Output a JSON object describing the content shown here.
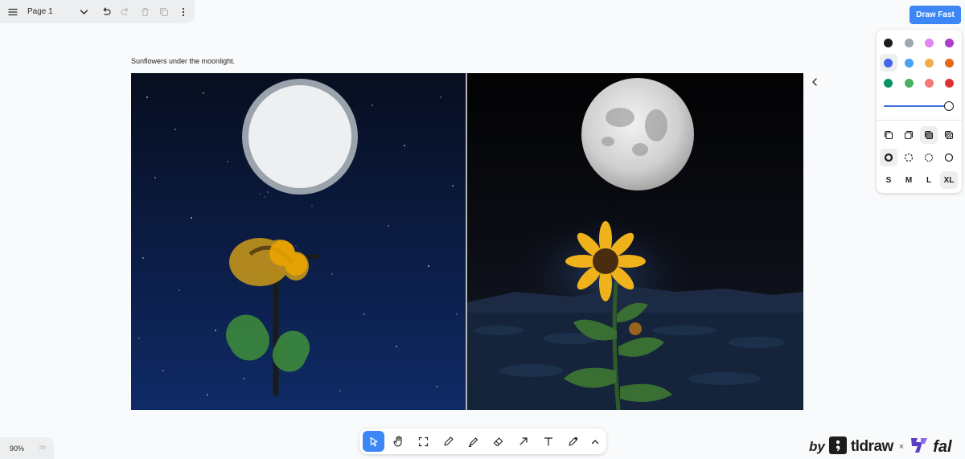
{
  "app": {
    "page": {
      "label": "Page 1"
    },
    "menu_icon": "hamburger-icon",
    "page_menu_icon": "chevron-down-icon",
    "undo_icon": "undo-icon",
    "redo_icon": "redo-icon",
    "delete_icon": "trash-icon",
    "duplicate_icon": "duplicate-icon",
    "more_icon": "more-vertical-icon"
  },
  "draw_fast": {
    "label": "Draw Fast",
    "color": "#3d86f5"
  },
  "style_panel": {
    "colors": [
      "#1d1d1d",
      "#9fa8b2",
      "#e085f4",
      "#ae3ec9",
      "#4465e9",
      "#4ba1f1",
      "#f1ac4b",
      "#e16919",
      "#099268",
      "#4cb05e",
      "#f87777",
      "#e03131"
    ],
    "selected_color": "#4465e9",
    "opacity": 1,
    "fill_icons": [
      "fill-none-icon",
      "fill-semi-icon",
      "fill-solid-icon",
      "fill-pattern-icon"
    ],
    "dash_icons": [
      "dash-draw-icon",
      "dash-dashed-icon",
      "dash-dotted-icon",
      "dash-solid-icon"
    ],
    "sizes": [
      "S",
      "M",
      "L",
      "XL"
    ],
    "selected_size": "XL"
  },
  "canvas": {
    "caption": "Sunflowers under the moonlight.",
    "collapse_icon": "chevron-left-icon"
  },
  "toolbar": {
    "tools": [
      "select-icon",
      "hand-icon",
      "frame-icon",
      "draw-icon",
      "highlight-icon",
      "eraser-icon",
      "arrow-icon",
      "text-icon",
      "laser-icon",
      "chevron-up-icon"
    ],
    "active_tool": "select-icon"
  },
  "zoom": {
    "label": "90%"
  },
  "brand": {
    "by": "by",
    "tldraw": "tldraw",
    "x": "×",
    "fal": "fal"
  }
}
